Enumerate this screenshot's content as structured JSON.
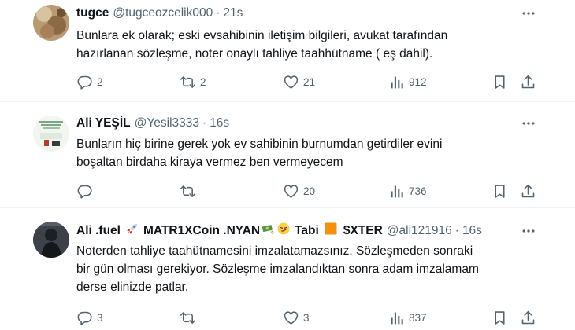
{
  "tweets": [
    {
      "display_name": "tugce",
      "handle": "@tugceozcelik000",
      "separator": "·",
      "time": "21s",
      "lines": [
        "Bunlara ek olarak; eski evsahibinin iletişim bilgileri, avukat tarafından",
        "hazırlanan sözleşme, noter onaylı tahliye taahhütname ( eş dahil)."
      ],
      "replies": "2",
      "retweets": "2",
      "likes": "21",
      "views": "912"
    },
    {
      "display_name": "Ali YEŞİL",
      "handle": "@Yesil3333",
      "separator": "·",
      "time": "16s",
      "lines": [
        "Bunların hiç birine gerek yok ev sahibinin burnumdan getirdiler evini",
        "boşaltan birdaha kiraya vermez ben vermeyecem"
      ],
      "replies": "",
      "retweets": "",
      "likes": "20",
      "views": "736"
    },
    {
      "display_name_parts": [
        "Ali .fuel",
        "MATR1XCoin .NYAN",
        "Tabi",
        "$XTER"
      ],
      "handle": "@ali121916",
      "separator": "·",
      "time": "16s",
      "lines": [
        "Noterden tahliye taahütnamesini imzalatamazsınız. Sözleşmeden sonraki",
        "bir gün olması gerekiyor. Sözleşme imzalandıktan sonra adam imzalamam",
        "derse elinizde patlar."
      ],
      "replies": "3",
      "retweets": "",
      "likes": "3",
      "views": "837"
    }
  ],
  "icons": {
    "reply": "reply-icon",
    "retweet": "retweet-icon",
    "like": "like-icon",
    "views": "views-icon",
    "bookmark": "bookmark-icon",
    "share": "share-icon",
    "more": "more-icon"
  },
  "colors": {
    "text": "#0f1419",
    "secondary": "#536471",
    "divider": "#eff3f4"
  }
}
